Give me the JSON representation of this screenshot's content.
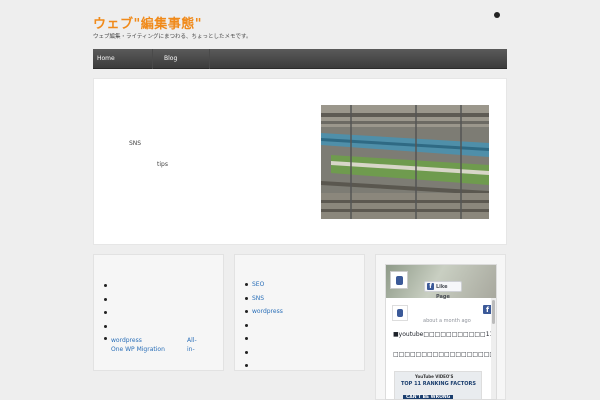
{
  "header": {
    "site_title": "ウェブ\"編集事態\"",
    "description": "ウェブ編集・ライティングにまつわる、ちょっとしたメモです。"
  },
  "nav": {
    "items": [
      {
        "label": "Home"
      },
      {
        "label": "Blog"
      }
    ]
  },
  "hero": {
    "sns": "SNS",
    "tips": "tips",
    "photo_icon": "train-photo"
  },
  "widget1": {
    "items": [
      "",
      "",
      "",
      ""
    ],
    "link_part1": "wordpress",
    "link_part2": "All-in-",
    "link_line2": "One WP Migration"
  },
  "widget2": {
    "items": [
      "SEO",
      "SNS",
      "wordpress",
      "",
      "",
      "",
      ""
    ]
  },
  "widget3": {
    "like_label": "Like Page",
    "logo_icon": "facebook-icon",
    "time": "about a month ago",
    "post_line1": "■youtube□□□□□□□□□□□11□□□",
    "post_line2": "□□□□□□□□□□□□□□□□□□□□□□□□□□□□□□□□□□□□...□□□□□□□□",
    "thumb_title": "YouTube VIDEO'S",
    "thumb_sub": "TOP 11 RANKING FACTORS",
    "thumb_tag": "CAN'T BE WRONG"
  }
}
